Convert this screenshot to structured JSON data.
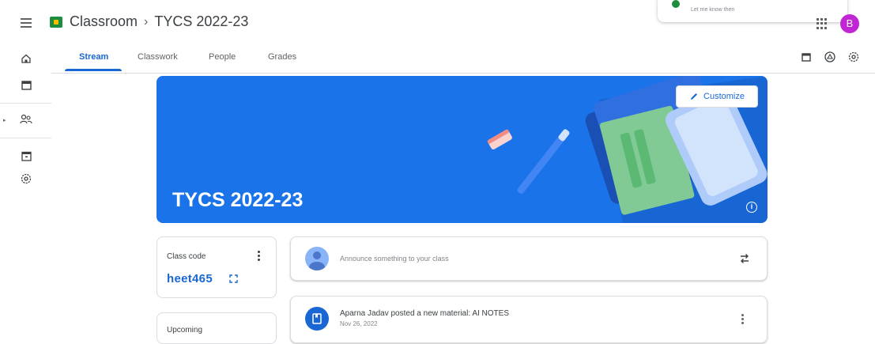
{
  "header": {
    "app_name": "Classroom",
    "separator": "›",
    "class_name": "TYCS 2022-23",
    "avatar_initial": "B"
  },
  "toast": {
    "text": "Let me know then"
  },
  "tabs": [
    {
      "label": "Stream",
      "active": true
    },
    {
      "label": "Classwork",
      "active": false
    },
    {
      "label": "People",
      "active": false
    },
    {
      "label": "Grades",
      "active": false
    }
  ],
  "right_icons": [
    "calendar-icon",
    "drive-icon",
    "settings-icon"
  ],
  "sidebar": {
    "items": [
      "home-icon",
      "calendar-icon",
      "people-icon",
      "archive-icon",
      "settings-icon"
    ]
  },
  "banner": {
    "title": "TYCS 2022-23",
    "customize_label": "Customize",
    "info_label": "i"
  },
  "class_code": {
    "label": "Class code",
    "value": "heet465"
  },
  "upcoming": {
    "label": "Upcoming"
  },
  "announce": {
    "placeholder": "Announce something to your class"
  },
  "posts": [
    {
      "title": "Aparna Jadav posted a new material: AI NOTES",
      "date": "Nov 26, 2022"
    }
  ],
  "colors": {
    "accent": "#1967d2",
    "banner": "#1a73e8",
    "avatar": "#c026d3",
    "logo": "#1e8e3e"
  }
}
